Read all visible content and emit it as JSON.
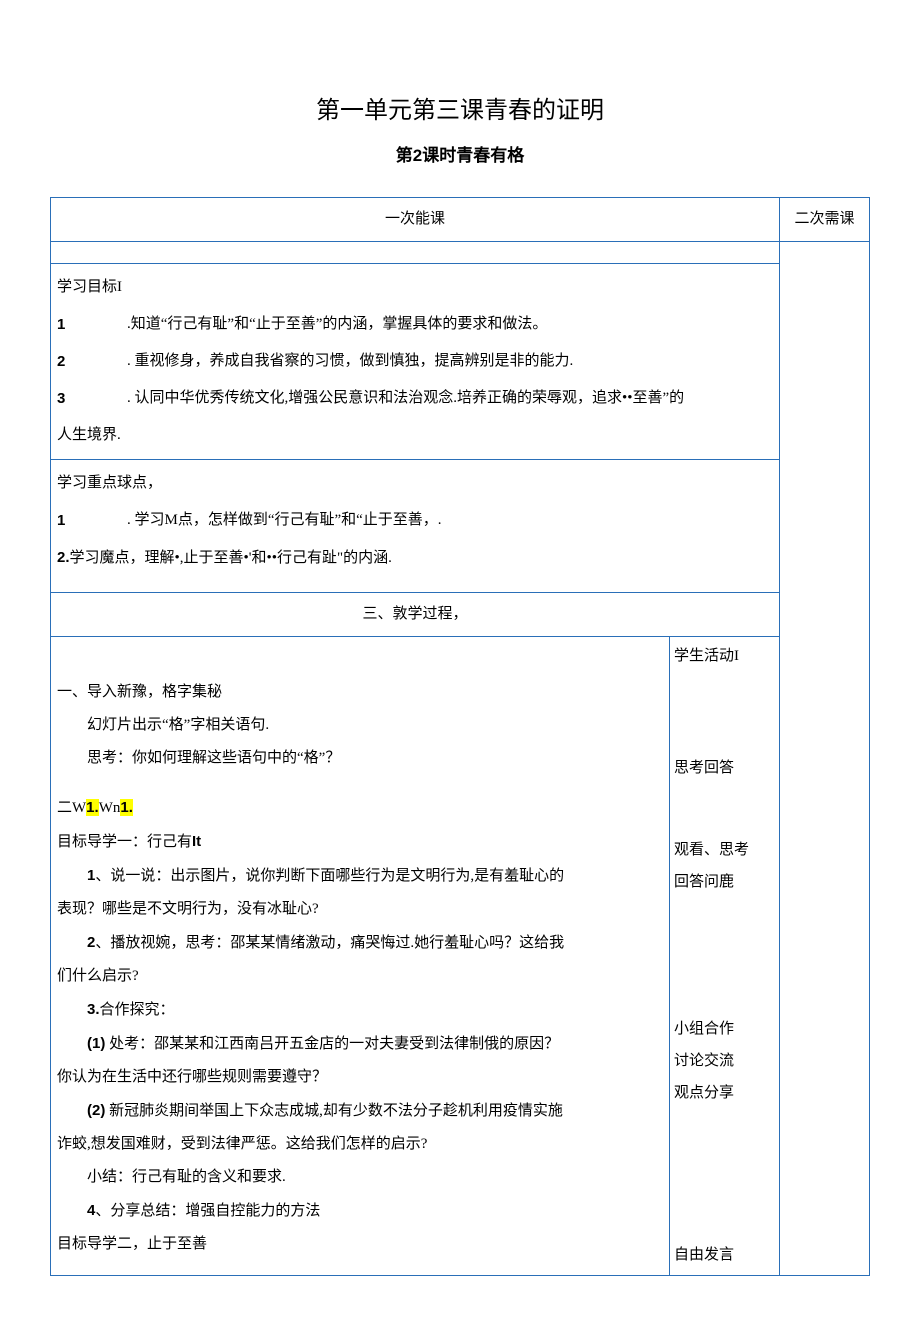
{
  "title_main": "第一单元第三课青春的证明",
  "title_sub": "第2课时青春有格",
  "headers": {
    "first": "一次能课",
    "second": "二次需课"
  },
  "objectives_title": "学习目标I",
  "objectives": {
    "o1_num": "1",
    "o1_text": ".知道“行己有耻”和“止于至善”的内涵，掌握具体的要求和做法。",
    "o2_num": "2",
    "o2_text": ". 重视修身，养成自我省察的习惯，做到慎独，提高辨别是非的能力.",
    "o3_num": "3",
    "o3_text": ". 认同中华优秀传统文化,增强公民意识和法治观念.培养正确的荣辱观，追求••至善”的",
    "o3_tail": "人生境界."
  },
  "keypoints_title": "学习重点球点，",
  "keypoints": {
    "k1_num": "1",
    "k1_text": ". 学习M点，怎样做到“行己有耻”和“止于至善，.",
    "k2": "2.学习魔点，理解•,止于至善•'和••行己有趾”的内涵."
  },
  "process_title": "三、敦学过程，",
  "sidebar": {
    "student_activity": "学生活动I",
    "think_answer": "思考回答",
    "watch_think": "观看、思考",
    "answer_q": "回答问鹿",
    "group": "小组合作",
    "discuss": "讨论交流",
    "share": "观点分享",
    "free": "自由发言"
  },
  "body": {
    "intro1": "一、导入新豫，格字集秘",
    "intro2": "幻灯片出示“格”字相关语句.",
    "intro3": "思考：你如何理解这些语句中的“格”？",
    "w_prefix": "二W",
    "w_h1": "1.",
    "w_mid": "Wn",
    "w_h2": "1.",
    "goal1": "目标导学一：行己有It",
    "p1": "1、说一说：出示图片，说你判断下面哪些行为是文明行为,是有羞耻心的",
    "p1_tail": "表现？哪些是不文明行为，没有冰耻心?",
    "p2": "2、播放视婉，思考：邵某某情绪激动，痛哭悔过.她行羞耻心吗？这给我",
    "p2_tail": "们什么启示?",
    "p3": "3.合作探究：",
    "p4": "(1) 处考：邵某某和江西南吕开五金店的一对夫妻受到法律制俄的原因？",
    "p4_tail": "你认为在生活中还行哪些规则需要遵守？",
    "p5": "(2) 新冠肺炎期间举国上下众志成城,却有少数不法分子趁机利用疫情实施",
    "p5_tail": "诈蛟,想发国难财，受到法律严惩。这给我们怎样的启示?",
    "p6": "小结：行己有耻的含义和要求.",
    "p7": "4、分享总结：增强自控能力的方法",
    "goal2": "目标导学二，止于至善"
  }
}
